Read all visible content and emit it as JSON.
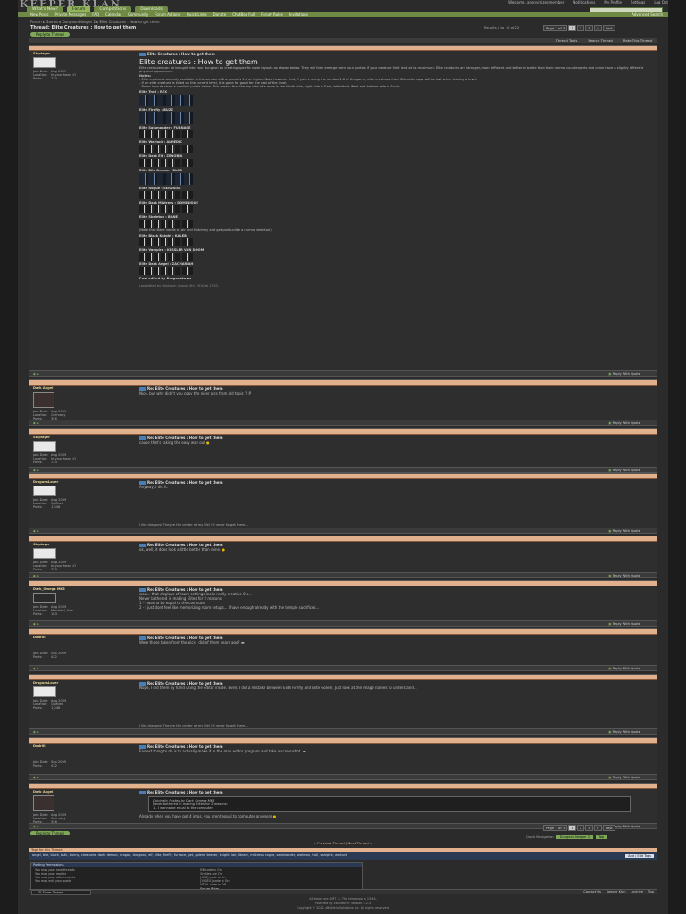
{
  "header": {
    "logo": "KEEPER KLAN",
    "welcome": "Welcome, anonymizedmember",
    "links": [
      "Notifications",
      "My Profile",
      "Settings",
      "Log Out"
    ]
  },
  "nav": {
    "tabs": [
      "What's New?",
      "Forum",
      "Competitions",
      "Downloads"
    ],
    "links": [
      "New Posts",
      "Private Messages",
      "FAQ",
      "Calendar",
      "Community",
      "Forum Actions",
      "Quick Links",
      "Donate",
      "ChatBox Full",
      "Forum Rules",
      "Invitations"
    ],
    "advanced_search": "Advanced Search"
  },
  "breadcrumb": "Forum ▸ Games ▸ Dungeon Keeper 2 ▸ Elite Creatures : How to get them",
  "thread": {
    "label": "Thread:",
    "title": "Elite Creatures : How to get them",
    "reply_button": "Reply to Thread",
    "results": "Results 1 to 10 of 22",
    "pager": [
      "Page 1 of 3",
      "1",
      "2",
      "3",
      ">",
      "Last"
    ],
    "tools": [
      "Thread Tools",
      "Search Thread",
      "Rate This Thread"
    ]
  },
  "posts": [
    {
      "user": "Skiplayer",
      "user_info": [
        "Join Date:",
        "Aug 2009",
        "Location:",
        "In your head :O",
        "Posts:",
        "723"
      ],
      "title": "Elite Creatures : How to get them",
      "headline": "Elite creatures : How to get them",
      "body": [
        "Elite creatures can be brought into your dungeon by creating specific room layouts as shown below. They will then emerge from your portals if your creature limit isn't at its maximum. Elite creatures are stronger, more efficient and better in battle than their normal counterparts and come have a slightly different physical appearance.",
        "Notes:",
        "- Elite creatures are only available in the version of the game is 1.6 or higher. Note however that, if you're using the version 1.6 of the game, elite creatures from Skirmish maps will be lost when leaving a level.",
        "- If an elite creature is killed on the current level, it is gone for good for the rest of the level.",
        "- Room layouts show a cardinal points below. This means that the top side of a room is the North side, right side is East, left side is West and bottom side is South."
      ],
      "elites": [
        "Elite Troll : REX",
        "Elite Firefly : BUZZ",
        "Elite Salamander : FURNACE",
        "Elite Warlock : ALHEDIC",
        "Elite Dark Elf : ZENOBIA",
        "Elite Bile Demon : BLOB",
        "Elite Rogue : SERVAISE",
        "Elite Dark Mistress : DOMINIQUE",
        "Elite Skeleton : BANE",
        "Elite Black Knight : KALEB",
        "Elite Vampire : KESSLER VAN DOOM",
        "Elite Dark Angel : ZACHARIAH"
      ],
      "note": "(Note that Bane needs a Lair and Hatchery and get paid unlike a normal skeleton)",
      "signed": "Post edited by DragonsLover",
      "edited": "Last edited by Skiplayer; August 4th, 2010 at 17:03."
    },
    {
      "user": "Dark Angel",
      "user_info": [
        "Join Date:",
        "Aug 2009",
        "Location:",
        "Germany",
        "Posts:",
        "356"
      ],
      "title": "Re: Elite Creatures : How to get them",
      "body": "Nice, but why didn't you copy the nicer pics from old topic ? :P"
    },
    {
      "user": "Skiplayer",
      "user_info": [
        "Join Date:",
        "Aug 2009",
        "Location:",
        "In your head :O",
        "Posts:",
        "723"
      ],
      "title": "Re: Elite Creatures : How to get them",
      "body": "cause that's taking the easy way out"
    },
    {
      "user": "DragonsLover",
      "user_info": [
        "Join Date:",
        "Aug 2009",
        "Location:",
        "Québec",
        "Posts:",
        "1,046"
      ],
      "title": "Re: Elite Creatures : How to get them",
      "body": "Anyway, I did it.",
      "signature": "I like dragons! They're the center of my life! I'll never forget them..."
    },
    {
      "user": "Skiplayer",
      "user_info": [
        "Join Date:",
        "Aug 2009",
        "Location:",
        "In your head :O",
        "Posts:",
        "723"
      ],
      "title": "Re: Elite Creatures : How to get them",
      "body": "ok, well, it does look a little better than mine."
    },
    {
      "user": "Dark_Omega MK3",
      "user_info": [
        "Join Date:",
        "Aug 2009",
        "Location:",
        "Montréal, Kan.",
        "Posts:",
        "183"
      ],
      "title": "Re: Elite Creatures : How to get them",
      "body": [
        "wow... that displays of room settings looks really creative 0.o...",
        "Never bothered in making Elites for 2 reasons:",
        "1 - I wanna be equal to the computer",
        "2 - I just dont feel like memorizing room setups... I have enough already with the temple sacrifices..."
      ]
    },
    {
      "user": "Dodrill",
      "user_info": [
        "Join Date:",
        "Sep 2009",
        "Posts:",
        "432"
      ],
      "title": "Re: Elite Creatures : How to get them",
      "body": "Were those taken from the pics I did of them years ago?"
    },
    {
      "user": "DragonsLover",
      "user_info": [
        "Join Date:",
        "Aug 2009",
        "Location:",
        "Québec",
        "Posts:",
        "1,046"
      ],
      "title": "Re: Elite Creatures : How to get them",
      "body": "Nope, I did them by hand using the editor inside. Even, I did a mistake between Elite Firefly and Elite Golem. Just look at the image names to understand...",
      "signature": "I like dragons! They're the center of my life! I'll never forget them..."
    },
    {
      "user": "Dodrill",
      "user_info": [
        "Join Date:",
        "Sep 2009",
        "Posts:",
        "432"
      ],
      "title": "Re: Elite Creatures : How to get them",
      "body": "Easiest thing to do is to actually make it in the map editor program and take a screenshot."
    },
    {
      "user": "Dark Angel",
      "user_info": [
        "Join Date:",
        "Aug 2009",
        "Location:",
        "Germany",
        "Posts:",
        "356"
      ],
      "title": "Re: Elite Creatures : How to get them",
      "quote_label": "Originally Posted by Dark_Omega MK3",
      "quote_lines": [
        "Never bothered in making Elites for 2 reasons:",
        "1 - I wanna be equal to the computer"
      ],
      "body": "Already when you have got 4 imps, you arent equal to computer anymore"
    }
  ],
  "reply_with_quote": "Reply With Quote",
  "bottom": {
    "prev_next": "« Previous Thread | Next Thread »",
    "quick_nav": "Quick Navigation",
    "quick_nav_value": "Dungeon Keeper 2",
    "top": "Top",
    "tags_label": "Tags for this Thread",
    "tags": "angel, bile, black, bulk, bunny, creatures, dark, demon, dragon, dungeon, elf, elite, firefly, furnace, get, golem, keeper, knight, lair, library, mistress, rogue, salamander, skeleton, troll, vampire, warlock",
    "add_tags": "Add / Edit Tags",
    "rules_title": "Posting Permissions",
    "rules_col1": [
      "You may post new threads",
      "You may post replies",
      "You may post attachments",
      "You may edit your posts"
    ],
    "rules_col2": [
      "BB code is On",
      "Smilies are On",
      "[IMG] code is On",
      "[VIDEO] code is On",
      "HTML code is Off"
    ],
    "forum_rules": "Forum Rules",
    "style": "-- KK Silver Theme",
    "footer_links": [
      "Contact Us",
      "Keeper Klan",
      "Archive",
      "Top"
    ],
    "times": "All times are GMT -5. The time now is 13:34.",
    "powered": "Powered by vBulletin® Version 4.2.5",
    "copyright": "Copyright © 2021 vBulletin Solutions Inc. All rights reserved."
  }
}
